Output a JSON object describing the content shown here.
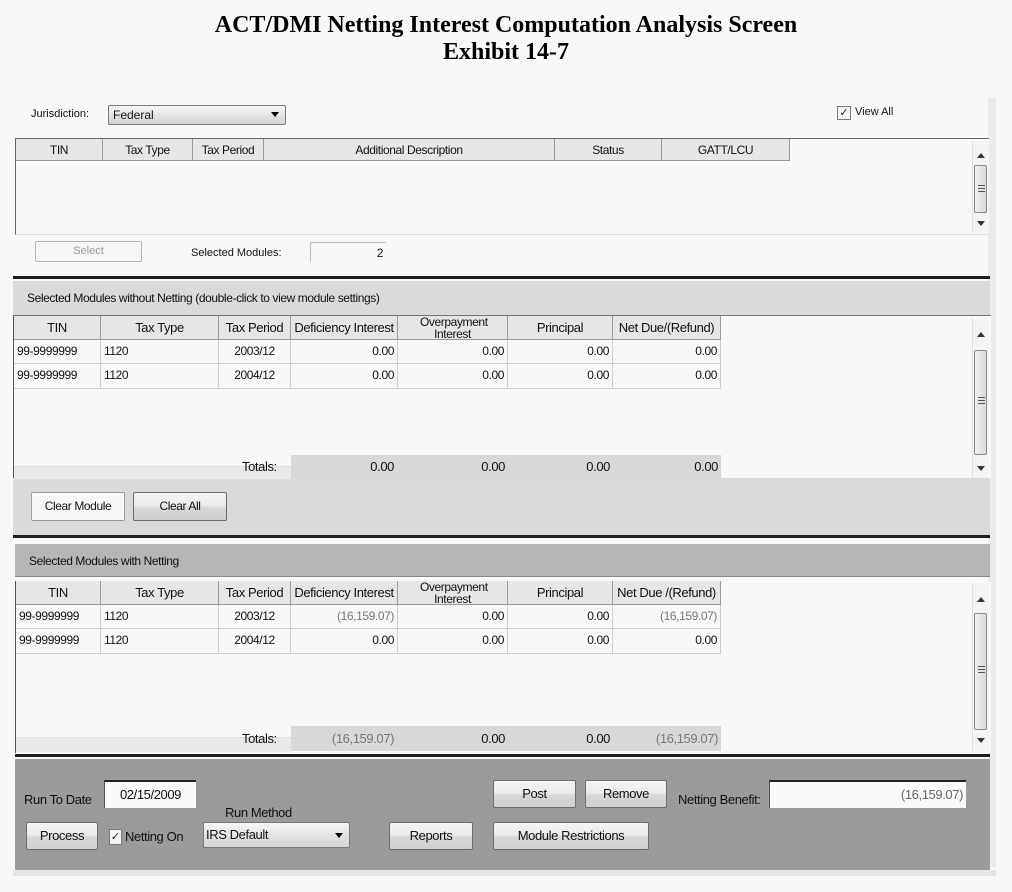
{
  "document": {
    "title_line1": "ACT/DMI Netting Interest Computation Analysis Screen",
    "title_line2": "Exhibit 14-7"
  },
  "filter": {
    "jurisdiction_label": "Jurisdiction:",
    "jurisdiction_value": "Federal",
    "view_all_label": "View All",
    "view_all_checked": true,
    "check_glyph": "✓"
  },
  "module_list": {
    "columns": [
      "TIN",
      "Tax Type",
      "Tax Period",
      "Additional Description",
      "Status",
      "GATT/LCU"
    ],
    "rows": [],
    "select_button": "Select",
    "selected_modules_label": "Selected Modules:",
    "selected_modules_value": "2"
  },
  "without_netting": {
    "section_title": "Selected Modules without Netting (double-click to view module settings)",
    "columns": [
      "TIN",
      "Tax Type",
      "Tax Period",
      "Deficiency Interest",
      "Overpayment Interest",
      "Principal",
      "Net Due/(Refund)"
    ],
    "rows": [
      {
        "tin": "99-9999999",
        "tax_type": "1120",
        "tax_period": "2003/12",
        "deficiency_interest": "0.00",
        "overpayment_interest": "0.00",
        "principal": "0.00",
        "net_due": "0.00"
      },
      {
        "tin": "99-9999999",
        "tax_type": "1120",
        "tax_period": "2004/12",
        "deficiency_interest": "0.00",
        "overpayment_interest": "0.00",
        "principal": "0.00",
        "net_due": "0.00"
      }
    ],
    "totals_label": "Totals:",
    "totals": {
      "deficiency_interest": "0.00",
      "overpayment_interest": "0.00",
      "principal": "0.00",
      "net_due": "0.00"
    },
    "clear_module_button": "Clear Module",
    "clear_all_button": "Clear All"
  },
  "with_netting": {
    "section_title": "Selected Modules with Netting",
    "columns": [
      "TIN",
      "Tax Type",
      "Tax Period",
      "Deficiency Interest",
      "Overpayment Interest",
      "Principal",
      "Net Due /(Refund)"
    ],
    "rows": [
      {
        "tin": "99-9999999",
        "tax_type": "1120",
        "tax_period": "2003/12",
        "deficiency_interest": "(16,159.07)",
        "overpayment_interest": "0.00",
        "principal": "0.00",
        "net_due": "(16,159.07)"
      },
      {
        "tin": "99-9999999",
        "tax_type": "1120",
        "tax_period": "2004/12",
        "deficiency_interest": "0.00",
        "overpayment_interest": "0.00",
        "principal": "0.00",
        "net_due": "0.00"
      }
    ],
    "totals_label": "Totals:",
    "totals": {
      "deficiency_interest": "(16,159.07)",
      "overpayment_interest": "0.00",
      "principal": "0.00",
      "net_due": "(16,159.07)"
    }
  },
  "controls": {
    "run_to_date_label": "Run To Date",
    "run_to_date_value": "02/15/2009",
    "run_method_label": "Run Method",
    "run_method_value": "IRS Default",
    "process_button": "Process",
    "netting_on_label": "Netting On",
    "netting_on_checked": true,
    "reports_button": "Reports",
    "post_button": "Post",
    "remove_button": "Remove",
    "module_restrictions_button": "Module Restrictions",
    "netting_benefit_label": "Netting Benefit:",
    "netting_benefit_value": "(16,159.07)"
  }
}
